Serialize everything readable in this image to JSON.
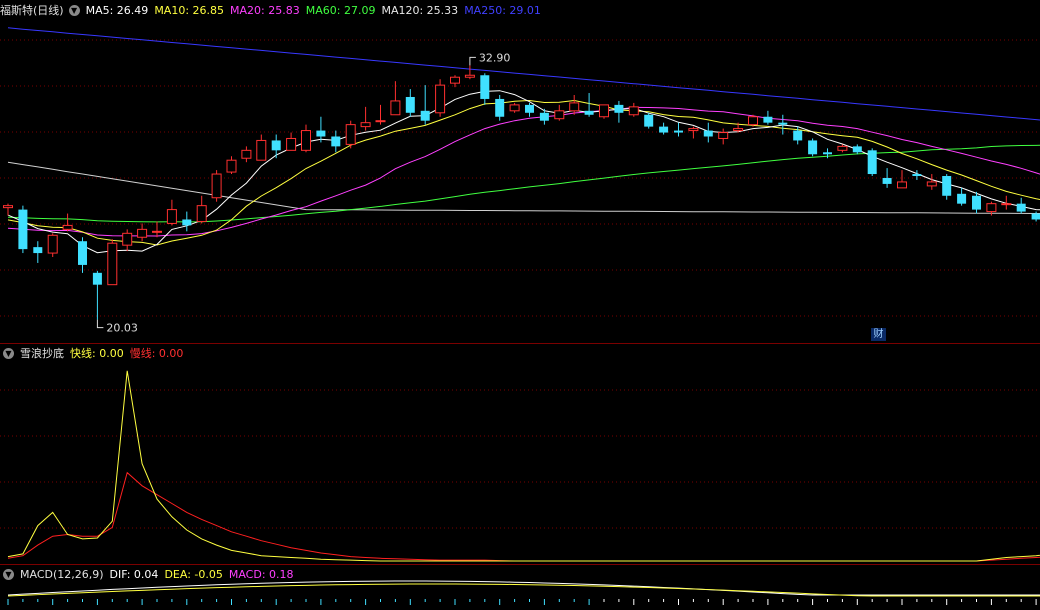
{
  "main": {
    "title": "福斯特(日线)",
    "ma": [
      {
        "label": "MA5: 26.49",
        "color": "#ffffff"
      },
      {
        "label": "MA10: 26.85",
        "color": "#ffff40"
      },
      {
        "label": "MA20: 25.83",
        "color": "#ff40ff"
      },
      {
        "label": "MA60: 27.09",
        "color": "#40ff40"
      },
      {
        "label": "MA120: 25.33",
        "color": "#e8e8e8"
      },
      {
        "label": "MA250: 29.01",
        "color": "#4040ff"
      }
    ],
    "high_label": "32.90",
    "low_label": "20.03",
    "event_tag": "财",
    "price_range": [
      19.0,
      35.5
    ]
  },
  "indicator": {
    "name": "雪浪抄底",
    "fast_label": "快线: 0.00",
    "slow_label": "慢线: 0.00",
    "fast_color": "#ffff40",
    "slow_color": "#ff2020"
  },
  "macd": {
    "name": "MACD(12,26,9)",
    "dif": "DIF: 0.04",
    "dea": "DEA: -0.05",
    "macd": "MACD: 0.18"
  },
  "colors": {
    "up": "#ff3030",
    "down": "#40e0ff",
    "bg": "#000000",
    "grid": "#7a0000"
  },
  "chart_data": {
    "type": "candlestick",
    "candles": [
      [
        25.7,
        25.8,
        25.3,
        25.9
      ],
      [
        25.6,
        23.6,
        23.4,
        25.8
      ],
      [
        23.7,
        23.4,
        22.9,
        24.0
      ],
      [
        23.4,
        24.3,
        23.2,
        24.4
      ],
      [
        24.6,
        24.8,
        24.5,
        25.4
      ],
      [
        24.0,
        22.8,
        22.4,
        24.2
      ],
      [
        22.4,
        21.8,
        20.03,
        22.5
      ],
      [
        21.8,
        23.9,
        21.8,
        24.1
      ],
      [
        23.8,
        24.4,
        23.5,
        24.6
      ],
      [
        24.2,
        24.6,
        24.0,
        24.9
      ],
      [
        24.5,
        24.5,
        24.2,
        25.0
      ],
      [
        24.9,
        25.6,
        24.8,
        26.1
      ],
      [
        25.1,
        24.8,
        24.5,
        25.5
      ],
      [
        25.0,
        25.8,
        24.9,
        26.3
      ],
      [
        26.2,
        27.4,
        26.0,
        27.6
      ],
      [
        27.5,
        28.1,
        27.4,
        28.3
      ],
      [
        28.2,
        28.6,
        28.0,
        28.8
      ],
      [
        28.1,
        29.1,
        28.1,
        29.4
      ],
      [
        29.1,
        28.6,
        28.2,
        29.4
      ],
      [
        28.6,
        29.2,
        28.6,
        29.5
      ],
      [
        28.6,
        29.6,
        28.5,
        29.9
      ],
      [
        29.6,
        29.3,
        29.0,
        30.3
      ],
      [
        29.3,
        28.8,
        28.5,
        29.6
      ],
      [
        28.9,
        29.9,
        28.7,
        30.1
      ],
      [
        29.8,
        30.0,
        29.6,
        30.8
      ],
      [
        30.1,
        30.1,
        29.9,
        30.9
      ],
      [
        30.4,
        31.1,
        30.4,
        32.1
      ],
      [
        31.3,
        30.5,
        30.3,
        31.7
      ],
      [
        30.6,
        30.1,
        29.9,
        31.9
      ],
      [
        30.5,
        31.9,
        30.3,
        32.2
      ],
      [
        32.0,
        32.3,
        31.8,
        32.4
      ],
      [
        32.3,
        32.4,
        32.2,
        32.9
      ],
      [
        32.4,
        31.2,
        30.9,
        32.5
      ],
      [
        31.2,
        30.3,
        30.1,
        31.4
      ],
      [
        30.6,
        30.9,
        30.5,
        31.0
      ],
      [
        30.9,
        30.5,
        30.3,
        31.0
      ],
      [
        30.5,
        30.1,
        29.9,
        30.7
      ],
      [
        30.2,
        30.6,
        30.1,
        30.9
      ],
      [
        30.6,
        31.0,
        30.4,
        31.4
      ],
      [
        30.6,
        30.4,
        30.3,
        31.5
      ],
      [
        30.3,
        30.9,
        30.2,
        30.9
      ],
      [
        30.9,
        30.5,
        30.0,
        31.1
      ],
      [
        30.4,
        30.8,
        30.3,
        31.0
      ],
      [
        30.4,
        29.8,
        29.7,
        30.5
      ],
      [
        29.8,
        29.5,
        29.4,
        30.0
      ],
      [
        29.6,
        29.5,
        29.3,
        30.0
      ],
      [
        29.6,
        29.7,
        29.2,
        29.8
      ],
      [
        29.6,
        29.3,
        29.0,
        30.0
      ],
      [
        29.2,
        29.5,
        28.9,
        29.7
      ],
      [
        29.6,
        29.7,
        29.5,
        30.0
      ],
      [
        29.9,
        30.3,
        29.8,
        30.4
      ],
      [
        30.3,
        30.0,
        29.9,
        30.6
      ],
      [
        30.0,
        29.9,
        29.4,
        30.4
      ],
      [
        29.6,
        29.1,
        28.9,
        29.8
      ],
      [
        29.1,
        28.4,
        28.3,
        29.2
      ],
      [
        28.5,
        28.4,
        28.2,
        28.7
      ],
      [
        28.6,
        28.8,
        28.5,
        28.9
      ],
      [
        28.8,
        28.5,
        28.4,
        28.9
      ],
      [
        28.6,
        27.4,
        27.3,
        28.7
      ],
      [
        27.2,
        26.9,
        26.7,
        27.7
      ],
      [
        26.7,
        27.0,
        26.7,
        27.6
      ],
      [
        27.4,
        27.3,
        27.1,
        27.6
      ],
      [
        26.8,
        27.0,
        26.6,
        27.4
      ],
      [
        27.3,
        26.3,
        26.1,
        27.4
      ],
      [
        26.4,
        25.9,
        25.8,
        26.7
      ],
      [
        26.3,
        25.6,
        25.4,
        26.5
      ],
      [
        25.5,
        25.9,
        25.3,
        26.0
      ],
      [
        25.9,
        25.9,
        25.6,
        26.3
      ],
      [
        25.9,
        25.5,
        25.4,
        26.2
      ],
      [
        25.4,
        25.1,
        25.0,
        25.5
      ],
      [
        25.0,
        25.5,
        24.8,
        25.6
      ],
      [
        24.9,
        25.8,
        24.8,
        25.9
      ],
      [
        26.0,
        26.9,
        25.8,
        26.9
      ],
      [
        27.0,
        27.0,
        26.6,
        27.7
      ],
      [
        28.1,
        28.6,
        27.9,
        28.8
      ],
      [
        28.7,
        28.7,
        28.6,
        29.0
      ],
      [
        28.5,
        28.9,
        28.5,
        29.1
      ],
      [
        29.1,
        28.6,
        28.4,
        29.2
      ],
      [
        28.6,
        28.8,
        28.5,
        29.1
      ],
      [
        28.8,
        28.3,
        28.2,
        29.2
      ],
      [
        28.3,
        28.5,
        28.2,
        28.6
      ],
      [
        28.5,
        28.3,
        28.1,
        28.8
      ],
      [
        28.3,
        28.2,
        27.9,
        28.5
      ],
      [
        28.2,
        27.9,
        27.8,
        28.6
      ],
      [
        27.9,
        28.2,
        27.7,
        28.4
      ],
      [
        28.0,
        27.6,
        27.3,
        28.1
      ],
      [
        27.6,
        27.4,
        26.9,
        28.0
      ]
    ],
    "indicator_fast": [
      0.5,
      0.8,
      4.0,
      5.5,
      3.0,
      2.5,
      2.6,
      4.5,
      21.5,
      11.0,
      7.0,
      5.0,
      3.5,
      2.5,
      1.8,
      1.2,
      0.9,
      0.6,
      0.5,
      0.4,
      0.3,
      0.2,
      0.15,
      0.1,
      0.05,
      0,
      0,
      0,
      0,
      0,
      0,
      0,
      0,
      0,
      0,
      0,
      0,
      0,
      0,
      0,
      0,
      0,
      0,
      0,
      0,
      0,
      0,
      0,
      0,
      0,
      0,
      0,
      0,
      0,
      0,
      0,
      0,
      0,
      0,
      0,
      0,
      0,
      0,
      0,
      0,
      0,
      0.2,
      0.4,
      0.5,
      0.6,
      0.8,
      1.1,
      1.0,
      0.6,
      0.4,
      0.3,
      0.2,
      0.2,
      0.1,
      0.1,
      0.1,
      0.1,
      0.1,
      0.1,
      0.1,
      0.1,
      0.1
    ],
    "indicator_slow": [
      0.3,
      0.6,
      1.8,
      2.8,
      3.0,
      2.8,
      2.8,
      3.8,
      10.0,
      8.5,
      7.5,
      6.5,
      5.5,
      4.7,
      4.0,
      3.3,
      2.8,
      2.3,
      1.9,
      1.5,
      1.2,
      0.9,
      0.7,
      0.5,
      0.4,
      0.3,
      0.25,
      0.2,
      0.15,
      0.1,
      0.1,
      0.1,
      0.1,
      0.05,
      0,
      0,
      0,
      0,
      0,
      0,
      0,
      0,
      0,
      0,
      0,
      0,
      0,
      0,
      0,
      0,
      0,
      0,
      0,
      0,
      0,
      0,
      0,
      0,
      0,
      0,
      0,
      0,
      0,
      0,
      0,
      0,
      0.1,
      0.2,
      0.3,
      0.4,
      0.5,
      0.7,
      0.7,
      0.6,
      0.5,
      0.4,
      0.3,
      0.25,
      0.2,
      0.15,
      0.1,
      0.1,
      0.1,
      0.1,
      0.1,
      0.1,
      0.1
    ],
    "indicator_range": [
      0,
      22.5
    ]
  }
}
